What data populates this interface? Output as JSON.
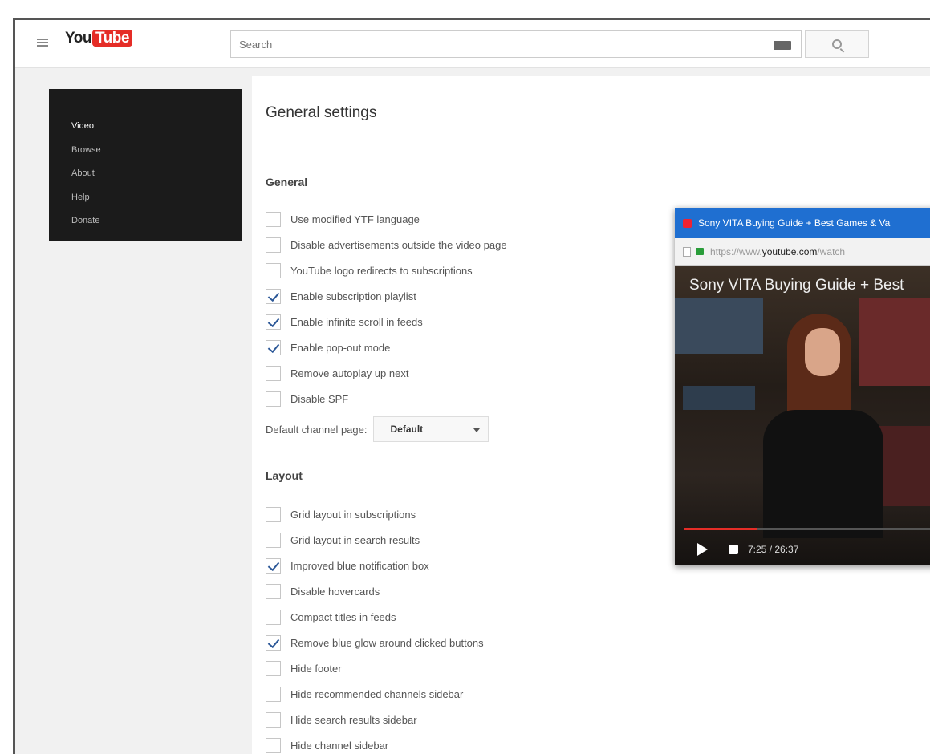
{
  "header": {
    "logo_text": "YouTube",
    "search_placeholder": "Search"
  },
  "sidebar": {
    "items": [
      {
        "label": "Video",
        "active": true
      },
      {
        "label": "Browse",
        "active": false
      },
      {
        "label": "About",
        "active": false
      },
      {
        "label": "Help",
        "active": false
      },
      {
        "label": "Donate",
        "active": false
      }
    ]
  },
  "main": {
    "page_title": "General settings",
    "sections": [
      {
        "title": "General",
        "options": [
          {
            "label": "Use modified YTF language",
            "checked": false
          },
          {
            "label": "Disable advertisements outside the video page",
            "checked": false
          },
          {
            "label": "YouTube logo redirects to subscriptions",
            "checked": false
          },
          {
            "label": "Enable subscription playlist",
            "checked": true
          },
          {
            "label": "Enable infinite scroll in feeds",
            "checked": true
          },
          {
            "label": "Enable pop-out mode",
            "checked": true
          },
          {
            "label": "Remove autoplay up next",
            "checked": false
          },
          {
            "label": "Disable SPF",
            "checked": false
          }
        ],
        "select": {
          "label": "Default channel page:",
          "value": "Default"
        }
      },
      {
        "title": "Layout",
        "options": [
          {
            "label": "Grid layout in subscriptions",
            "checked": false
          },
          {
            "label": "Grid layout in search results",
            "checked": false
          },
          {
            "label": "Improved blue notification box",
            "checked": true
          },
          {
            "label": "Disable hovercards",
            "checked": false
          },
          {
            "label": "Compact titles in feeds",
            "checked": false
          },
          {
            "label": "Remove blue glow around clicked buttons",
            "checked": true
          },
          {
            "label": "Hide footer",
            "checked": false
          },
          {
            "label": "Hide recommended channels sidebar",
            "checked": false
          },
          {
            "label": "Hide search results sidebar",
            "checked": false
          },
          {
            "label": "Hide channel sidebar",
            "checked": false
          }
        ]
      }
    ]
  },
  "popout": {
    "window_title": "Sony VITA Buying Guide + Best Games & Va",
    "url_prefix": "https://www.",
    "url_host": "youtube.com",
    "url_suffix": "/watch",
    "video_title": "Sony VITA Buying Guide + Best",
    "time": "7:25 / 26:37",
    "progress_fraction": 0.28
  },
  "colors": {
    "sidebar_bg": "#1b1b1b",
    "checkbox_mark": "#2b5797",
    "popout_title_bg": "#1f6fd1",
    "progress": "#e52d27"
  },
  "icons": [
    "hamburger-menu-icon",
    "keyboard-icon",
    "search-icon",
    "favicon-icon",
    "lock-icon",
    "play-icon",
    "volume-icon"
  ]
}
